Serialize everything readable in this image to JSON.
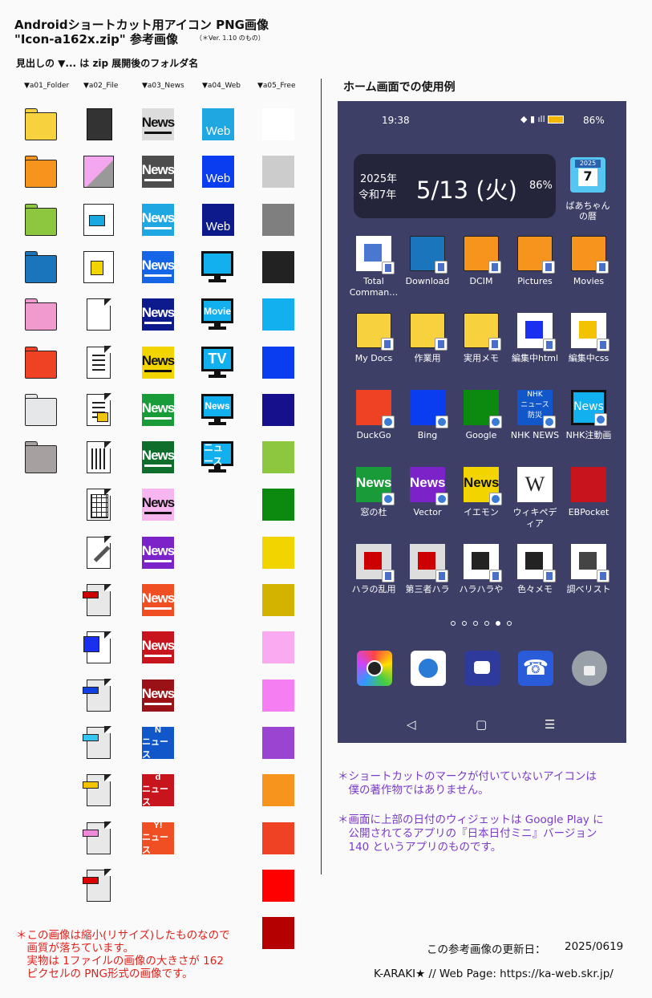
{
  "header": {
    "title_line1": "Androidショートカット用アイコン PNG画像",
    "title_line2": "\"Icon-a162x.zip\"  参考画像",
    "version_note": "（＊Ver. 1.10 のもの）",
    "subtitle": "見出しの ▼... は zip 展開後のフォルダ名"
  },
  "columns": [
    "▼a01_Folder",
    "▼a02_File",
    "▼a03_News",
    "▼a04_Web",
    "▼a05_Free"
  ],
  "folder_colors": [
    "#f7d23e",
    "#f7941d",
    "#8dc63f",
    "#1b75bc",
    "#f19ad0",
    "#ef4123",
    "#e6e7e8",
    "#a7a0a0"
  ],
  "news_icons": [
    {
      "text": "News",
      "bg": "#dcdcdc",
      "fg": "#111"
    },
    {
      "text": "News",
      "bg": "#4d4d4d",
      "fg": "#fff"
    },
    {
      "text": "News",
      "bg": "#1ea7e1",
      "fg": "#fff"
    },
    {
      "text": "News",
      "bg": "#1565e6",
      "fg": "#fff"
    },
    {
      "text": "News",
      "bg": "#0d1a8c",
      "fg": "#fff"
    },
    {
      "text": "News",
      "bg": "#f2d500",
      "fg": "#111"
    },
    {
      "text": "News",
      "bg": "#1a9b3a",
      "fg": "#fff"
    },
    {
      "text": "News",
      "bg": "#0f6e2c",
      "fg": "#fff"
    },
    {
      "text": "News",
      "bg": "#f7b6f0",
      "fg": "#111"
    },
    {
      "text": "News",
      "bg": "#7c22c9",
      "fg": "#fff"
    },
    {
      "text": "News",
      "bg": "#f04e23",
      "fg": "#fff"
    },
    {
      "text": "News",
      "bg": "#c8141d",
      "fg": "#fff"
    },
    {
      "text": "News",
      "bg": "#9a1116",
      "fg": "#fff"
    },
    {
      "text": "N\nニュース",
      "bg": "#1257c9",
      "fg": "#fff"
    },
    {
      "text": "d\nニュース",
      "bg": "#c8141d",
      "fg": "#fff"
    },
    {
      "text": "Y!\nニュース",
      "bg": "#f04e23",
      "fg": "#fff"
    }
  ],
  "web_icons": [
    {
      "text": "Web",
      "bg": "#1ea7e1"
    },
    {
      "text": "Web",
      "bg": "#0a3cf0"
    },
    {
      "text": "Web",
      "bg": "#0d1a8c"
    },
    {
      "text": "",
      "bg": "#12b0ef"
    },
    {
      "text": "Movie",
      "bg": "#12b0ef"
    },
    {
      "text": "TV",
      "bg": "#12b0ef"
    },
    {
      "text": "News",
      "bg": "#12b0ef"
    },
    {
      "text": "ニュース",
      "bg": "#12b0ef"
    }
  ],
  "free_colors": [
    "#ffffff",
    "#cccccc",
    "#7f7f7f",
    "#222222",
    "#12b0ef",
    "#0a3cf0",
    "#16108c",
    "#8dc63f",
    "#0b8a0f",
    "#f2d500",
    "#d4b200",
    "#f9aaf1",
    "#f57ef2",
    "#9b44d1",
    "#f7941d",
    "#ef4123",
    "#ff0000",
    "#b50000"
  ],
  "home": {
    "title": "ホーム画面での使用例",
    "status_time": "19:38",
    "battery": "86%",
    "widget_year": "2025年",
    "widget_era": "令和7年",
    "widget_date": "5/13 (火)",
    "widget_percent": "86%",
    "calendar_app_label": "ばあちゃん\nの暦",
    "calendar_icon_year": "2025",
    "calendar_icon_day": "7",
    "rows": [
      [
        "Total\nComman…",
        "Download",
        "DCIM",
        "Pictures",
        "Movies"
      ],
      [
        "My Docs",
        "作業用",
        "実用メモ",
        "編集中html",
        "編集中css"
      ],
      [
        "DuckGo",
        "Bing",
        "Google",
        "NHK NEWS",
        "NHK注動画"
      ],
      [
        "窓の杜",
        "Vector",
        "イエモン",
        "ウィキペデ\nィア",
        "EBPocket"
      ],
      [
        "ハラの乱用",
        "第三者ハラ",
        "ハラハラや",
        "色々メモ",
        "調べリスト"
      ]
    ],
    "nhk_icon_line1": "NHK",
    "nhk_icon_line2": "ニュース",
    "nhk_icon_line3": "防災",
    "wiki_glyph": "W",
    "nav_back": "◁",
    "nav_home": "▢",
    "nav_menu": "☰"
  },
  "notes_right": [
    "＊ショートカットのマークが付いていないアイコンは\n　僕の著作物ではありません。",
    "＊画面に上部の日付のウィジェットは Google Play に\n　公開されてるアプリの『日本日付ミニ』バージョン\n　140 というアプリのものです。"
  ],
  "note_left": "＊この画像は縮小(リサイズ)したものなので\n　画質が落ちています。\n　実物は 1ファイルの画像の大きさが 162\n　ピクセルの PNG形式の画像です。",
  "updated_label": "この参考画像の更新日：",
  "updated_date": "2025/0619",
  "footer": "K-ARAKI★  //  Web Page:  https://ka-web.skr.jp/"
}
